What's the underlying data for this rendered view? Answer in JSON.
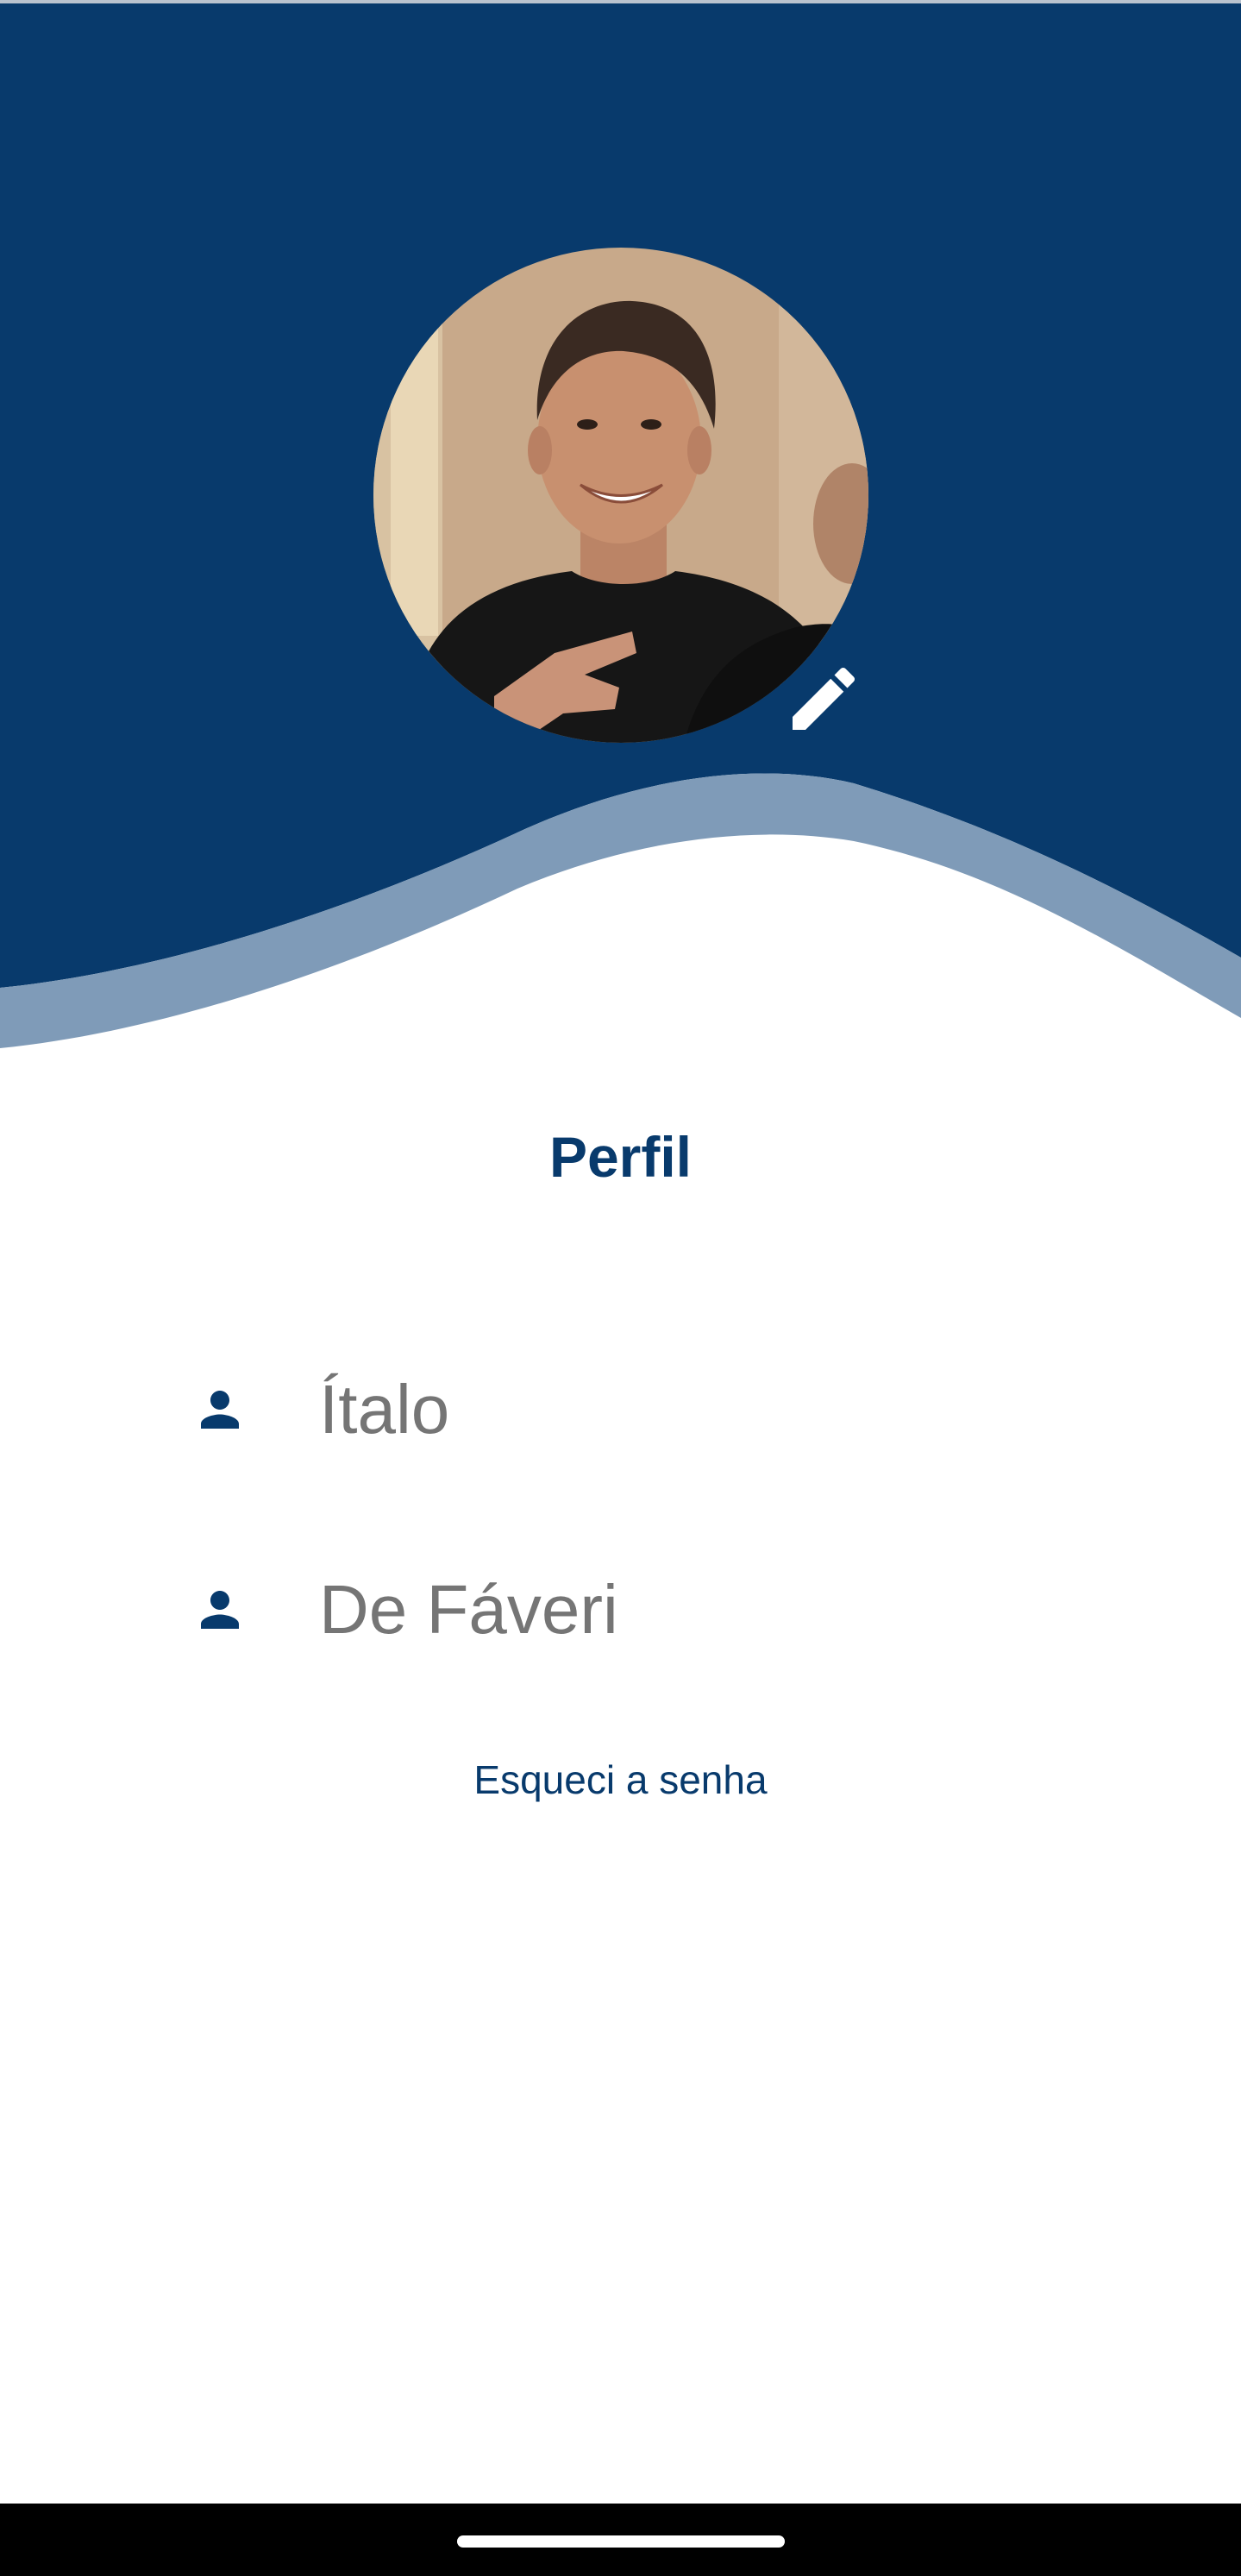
{
  "screen": {
    "title": "Perfil",
    "colors": {
      "primary": "#083a6c",
      "wave_accent": "#7f9bb8",
      "text_muted": "#757575",
      "background": "#ffffff"
    }
  },
  "profile": {
    "avatar_icon": "profile-photo",
    "edit_icon": "pencil-icon"
  },
  "fields": {
    "first_name": {
      "value": "Ítalo",
      "icon": "person-icon"
    },
    "last_name": {
      "value": "De Fáveri",
      "icon": "person-icon"
    }
  },
  "links": {
    "forgot_password": "Esqueci a senha"
  }
}
